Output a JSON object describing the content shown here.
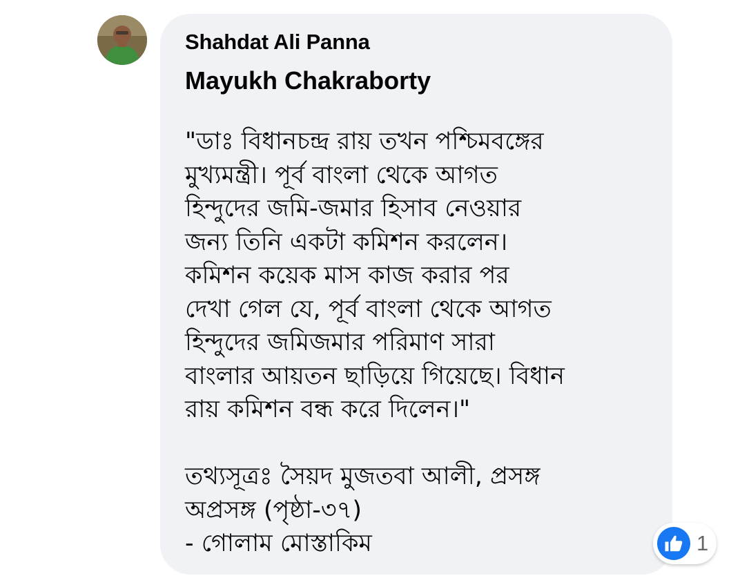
{
  "comment": {
    "author_name": "Shahdat Ali Panna",
    "tagged_name": "Mayukh Chakraborty",
    "quote_lines": [
      "\"ডাঃ বিধানচন্দ্র রায় তখন পশ্চিমবঙ্গের",
      "মুখ্যমন্ত্রী। পূর্ব বাংলা থেকে আগত",
      "হিন্দুদের জমি-জমার হিসাব নেওয়ার",
      "জন্য তিনি একটা কমিশন করলেন।",
      "কমিশন কয়েক মাস কাজ করার পর",
      "দেখা গেল যে, পূর্ব বাংলা থেকে আগত",
      "হিন্দুদের জমিজমার পরিমাণ সারা",
      "বাংলার আয়তন ছাড়িয়ে গিয়েছে। বিধান",
      "রায় কমিশন বন্ধ করে দিলেন।\""
    ],
    "source_lines": [
      "তথ্যসূত্রঃ সৈয়দ মুজতবা আলী, প্রসঙ্গ",
      "অপ্রসঙ্গ (পৃষ্ঠা-৩৭)",
      "- গোলাম মোস্তাকিম"
    ]
  },
  "reactions": {
    "icon": "like-icon",
    "count": "1",
    "color": "#1877f2"
  },
  "colors": {
    "bubble_bg": "#f0f2f5",
    "text": "#050505",
    "count_text": "#65676b"
  }
}
